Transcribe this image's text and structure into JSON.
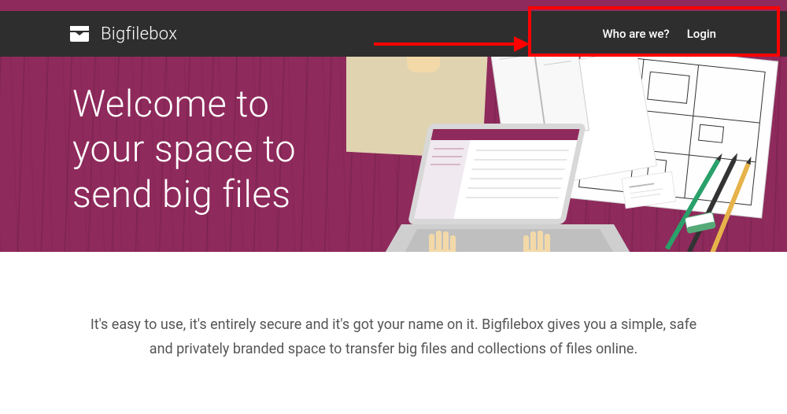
{
  "brand": {
    "name": "Bigfilebox"
  },
  "nav": {
    "who": "Who are we?",
    "login": "Login"
  },
  "hero": {
    "line1": "Welcome to",
    "line2": "your space to",
    "line3": "send big files"
  },
  "body": {
    "paragraph": "It's easy to use, it's entirely secure and it's got your name on it. Bigfilebox gives you a simple, safe and privately branded space to transfer big files and collections of files online."
  },
  "colors": {
    "accent": "#8f2a5c",
    "navbar": "#2e2e2e",
    "annotation": "#ff0000"
  }
}
